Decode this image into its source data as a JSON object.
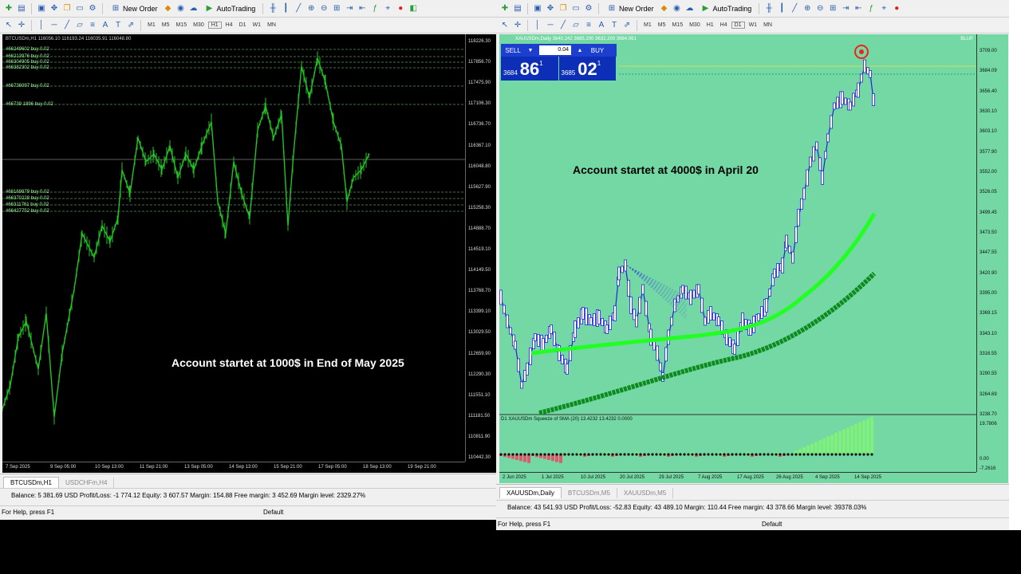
{
  "left_window": {
    "toolbar": {
      "new_order_label": "New Order",
      "autotrading_label": "AutoTrading",
      "timeframes": [
        "M1",
        "M5",
        "M15",
        "M30",
        "H1",
        "H4",
        "D1",
        "W1",
        "MN"
      ]
    },
    "chart": {
      "ohlc": "BTCUSDm,H1 116056.10 116193.24 116035.91 116048.80",
      "overlay_text": "Account startet at 1000$ in End of May 2025",
      "price_scale": [
        "118226.30",
        "117856.70",
        "117475.90",
        "117106.30",
        "116736.70",
        "116367.10",
        "116048.80",
        "115627.90",
        "115258.30",
        "114888.70",
        "114519.10",
        "114149.50",
        "113768.70",
        "113399.10",
        "113029.50",
        "112659.90",
        "112290.30",
        "111551.10",
        "111181.50",
        "110811.90",
        "110442.30"
      ],
      "time_scale": [
        "7 Sep 2025",
        "9 Sep 05:00",
        "10 Sep 13:00",
        "11 Sep 21:00",
        "13 Sep 05:00",
        "14 Sep 13:00",
        "15 Sep 21:00",
        "17 Sep 05:00",
        "18 Sep 13:00",
        "19 Sep 21:00"
      ],
      "orders": [
        "#66249602 buy 0.02",
        "#66213976 buy 0.02",
        "#66304905 buy 0.02",
        "#66382302 buy 0.02",
        "#66736097 buy 0.02",
        "#66739 1896 buy 0.02",
        "#68169879 buy 0.02",
        "#66370228 buy 0.02",
        "#66311761 buy 0.02",
        "#66427752 buy 0.02"
      ]
    },
    "tabs": [
      "BTCUSDm,H1",
      "USDCHFm,H4"
    ],
    "status": "Balance: 5 381.69 USD  Profit/Loss: -1 774.12  Equity: 3 607.57  Margin: 154.88  Free margin: 3 452.69  Margin level: 2329.27%",
    "help": "For Help, press F1",
    "profile": "Default"
  },
  "right_window": {
    "toolbar": {
      "new_order_label": "New Order",
      "autotrading_label": "AutoTrading",
      "timeframes": [
        "M1",
        "M5",
        "M15",
        "M30",
        "H1",
        "H4",
        "D1",
        "W1",
        "MN"
      ]
    },
    "chart": {
      "ohlc": "XAUUSDm,Daily  3640.242 3685.200 3632.200 3684.061",
      "overlay_text": "Account startet at 4000$ in April 20",
      "trade_panel": {
        "sell_label": "SELL",
        "buy_label": "BUY",
        "lot": "0.04",
        "sell_small": "3684",
        "sell_big": "86",
        "sell_sup": "1",
        "buy_small": "3685",
        "buy_big": "02",
        "buy_sup": "1"
      },
      "price_scale": [
        "3709.00",
        "3684.09",
        "3656.40",
        "3630.10",
        "3603.10",
        "3577.90",
        "3552.00",
        "3526.05",
        "3499.45",
        "3473.50",
        "3447.55",
        "3420.90",
        "3395.00",
        "3369.15",
        "3343.10",
        "3316.55",
        "3290.55",
        "3264.69",
        "3238.70"
      ],
      "time_scale": [
        "2 Jun 2025",
        "1 Jul 2025",
        "10 Jul 2025",
        "20 Jul 2025",
        "29 Jul 2025",
        "7 Aug 2025",
        "17 Aug 2025",
        "26 Aug 2025",
        "4 Sep 2025",
        "14 Sep 2025"
      ],
      "indicator_label": "D1 XAUUSDm Squeeze of SMA (20) 13.4232 13.4232 0.0000",
      "indicator_scale": [
        "19.7806",
        "0.00",
        "-7.2616"
      ],
      "corner_label": "BLUP"
    },
    "tabs": [
      "XAUUSDm,Daily",
      "BTCUSDm,M5",
      "XAUUSDm,M5"
    ],
    "status": "Balance: 43 541.93 USD  Profit/Loss: -52.83  Equity: 43 489.10  Margin: 110.44  Free margin: 43 378.66  Margin level: 39378.03%",
    "help": "For Help, press F1",
    "profile": "Default"
  },
  "colors": {
    "left_bg": "#000000",
    "left_candles": "#22c322",
    "right_bg": "#74d8a4",
    "right_candles": "#2222dd",
    "ma_fast": "#22ff22",
    "ma_slow": "#0e8a1e"
  }
}
